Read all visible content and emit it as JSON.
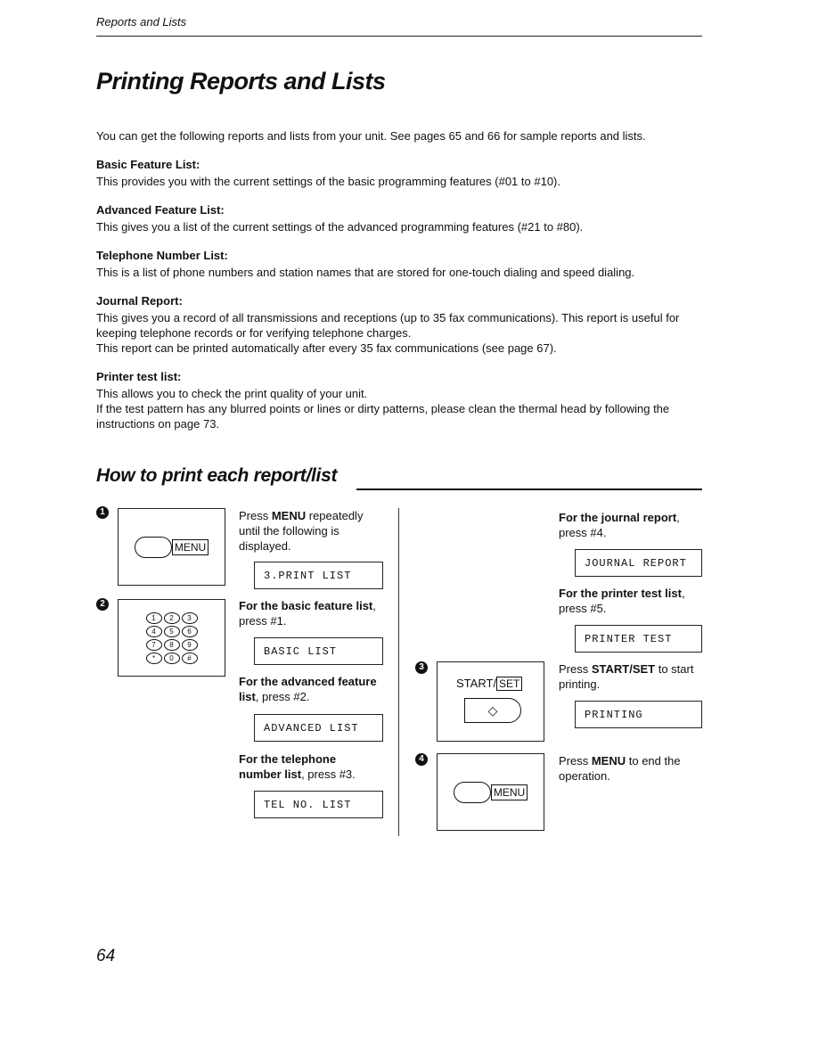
{
  "header": {
    "section": "Reports and Lists"
  },
  "title": "Printing Reports and Lists",
  "intro": "You can get the following reports and lists from your unit. See pages 65 and 66 for sample reports and lists.",
  "sections": [
    {
      "heading": "Basic Feature List:",
      "lines": [
        "This provides you with the current settings of the basic programming features (#01 to #10)."
      ]
    },
    {
      "heading": "Advanced Feature List:",
      "lines": [
        "This gives you a list of the current settings of the advanced programming features (#21 to #80)."
      ]
    },
    {
      "heading": "Telephone Number List:",
      "lines": [
        "This is a list of phone numbers and station names that are stored for one-touch dialing and speed dialing."
      ]
    },
    {
      "heading": "Journal Report:",
      "lines": [
        "This gives you a record of all transmissions and receptions (up to 35 fax communications). This report is useful for keeping telephone records or for verifying telephone charges.",
        "This report can be printed automatically after every 35 fax communications (see page 67)."
      ]
    },
    {
      "heading": "Printer test list:",
      "lines": [
        "This allows you to check the print quality of your unit.",
        "If the test pattern has any blurred points or lines or dirty patterns, please clean the thermal head by following the instructions on page 73."
      ]
    }
  ],
  "how_to": {
    "heading": "How to print each report/list",
    "step_numbers": [
      "1",
      "2",
      "3",
      "4"
    ],
    "menu_key": "MENU",
    "keypad": [
      "1",
      "2",
      "3",
      "4",
      "5",
      "6",
      "7",
      "8",
      "9",
      "*",
      "0",
      "#"
    ],
    "start_key": "START/",
    "set_key": "SET",
    "start_symbol": "◇",
    "step1": {
      "pre": "Press ",
      "bold": "MENU",
      "post": " repeatedly until the following is displayed.",
      "display": "3.PRINT LIST"
    },
    "basic": {
      "bold": "For the basic feature list",
      "post": ", press #1.",
      "display": "BASIC LIST"
    },
    "advanced": {
      "bold": "For the advanced feature list",
      "post": ", press #2.",
      "display": "ADVANCED LIST"
    },
    "telephone": {
      "bold": "For the telephone number list",
      "post": ", press #3.",
      "display": "TEL NO. LIST"
    },
    "journal": {
      "bold": "For the journal report",
      "post": ", press #4.",
      "display": "JOURNAL REPORT"
    },
    "printer": {
      "bold": "For the printer test list",
      "post": ", press #5.",
      "display": "PRINTER TEST"
    },
    "step3": {
      "pre": "Press ",
      "bold": "START/SET",
      "post": " to start printing.",
      "display": "PRINTING"
    },
    "step4": {
      "pre": "Press ",
      "bold": "MENU",
      "post": " to end the operation."
    }
  },
  "page_number": "64"
}
